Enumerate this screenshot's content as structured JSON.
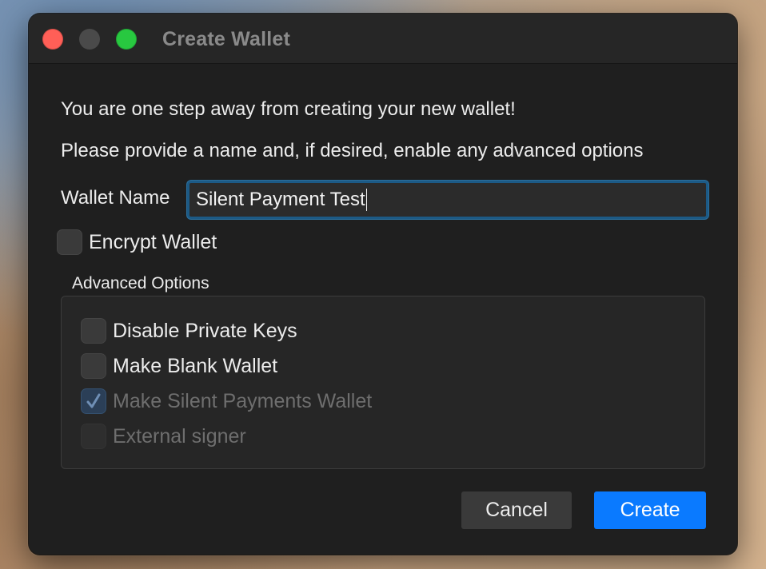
{
  "window": {
    "title": "Create Wallet"
  },
  "intro": {
    "line1": "You are one step away from creating your new wallet!",
    "line2": "Please provide a name and, if desired, enable any advanced options"
  },
  "wallet_name": {
    "label": "Wallet Name",
    "value": "Silent Payment Test"
  },
  "encrypt_wallet": {
    "label": "Encrypt Wallet",
    "checked": false,
    "enabled": true
  },
  "advanced_options": {
    "title": "Advanced Options",
    "options": [
      {
        "label": "Disable Private Keys",
        "checked": false,
        "enabled": true
      },
      {
        "label": "Make Blank Wallet",
        "checked": false,
        "enabled": true
      },
      {
        "label": "Make Silent Payments Wallet",
        "checked": true,
        "enabled": false
      },
      {
        "label": "External signer",
        "checked": false,
        "enabled": false
      }
    ]
  },
  "buttons": {
    "cancel": "Cancel",
    "create": "Create"
  },
  "colors": {
    "accent": "#0a7aff",
    "focus_ring": "#1c5a86",
    "close": "#ff5f57",
    "zoom": "#28c840"
  },
  "icons": {
    "check": "checkmark-icon"
  }
}
